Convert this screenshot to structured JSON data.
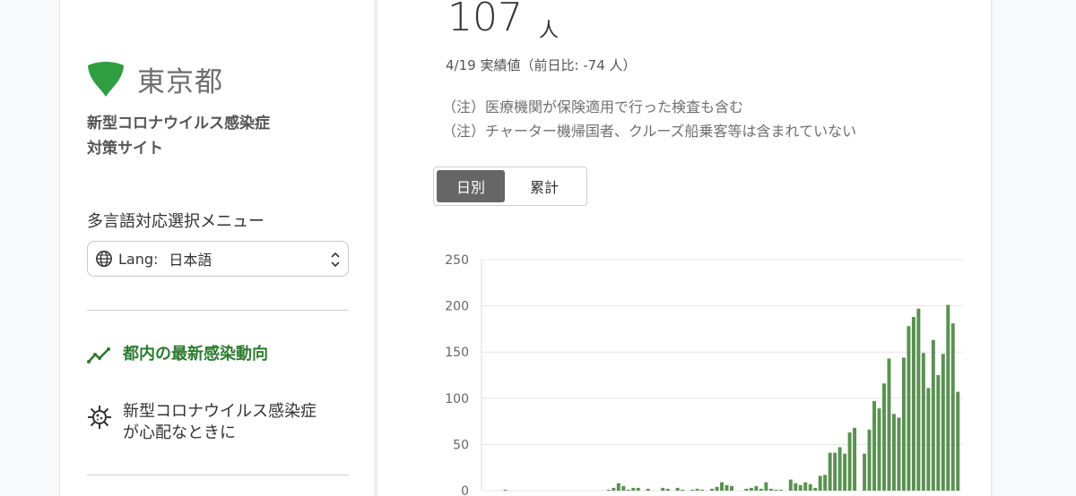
{
  "sidebar": {
    "logo_text": "東京都",
    "site_title_line1": "新型コロナウイルス感染症",
    "site_title_line2": "対策サイト",
    "lang_heading": "多言語対応選択メニュー",
    "lang_select": {
      "prefix": "Lang:",
      "value": "日本語"
    },
    "nav": [
      {
        "label": "都内の最新感染動向",
        "icon": "trend-line-icon",
        "active": true
      },
      {
        "label_line1": "新型コロナウイルス感染症",
        "label_line2": "が心配なときに",
        "icon": "virus-icon",
        "active": false
      }
    ]
  },
  "main": {
    "count_value": "107",
    "count_unit": "人",
    "sub_line": "4/19 実績値（前日比: -74 人）",
    "notes": [
      "（注）医療機関が保険適用で行った検査も含む",
      "（注）チャーター機帰国者、クルーズ船乗客等は含まれていない"
    ],
    "toggle": {
      "daily": "日別",
      "cumulative": "累計",
      "selected": "daily"
    }
  },
  "colors": {
    "accent_green": "#2d7a2f",
    "bar_green": "#5a9152",
    "toggle_active": "#666666"
  },
  "chart_data": {
    "type": "bar",
    "ylim": [
      0,
      250
    ],
    "yticks": [
      0,
      50,
      100,
      150,
      200,
      250
    ],
    "values": [
      0,
      0,
      0,
      0,
      1,
      0,
      0,
      0,
      0,
      0,
      0,
      0,
      0,
      0,
      0,
      0,
      0,
      0,
      0,
      0,
      0,
      0,
      0,
      0,
      0,
      1,
      3,
      8,
      5,
      1,
      3,
      3,
      0,
      2,
      0,
      0,
      3,
      2,
      0,
      3,
      1,
      0,
      1,
      2,
      1,
      0,
      2,
      4,
      9,
      6,
      5,
      0,
      0,
      2,
      3,
      5,
      2,
      9,
      2,
      1,
      1,
      0,
      12,
      8,
      6,
      9,
      7,
      3,
      16,
      17,
      41,
      41,
      47,
      40,
      63,
      68,
      0,
      40,
      66,
      97,
      89,
      116,
      143,
      83,
      79,
      144,
      178,
      188,
      197,
      149,
      111,
      163,
      125,
      148,
      201,
      181,
      107
    ]
  }
}
